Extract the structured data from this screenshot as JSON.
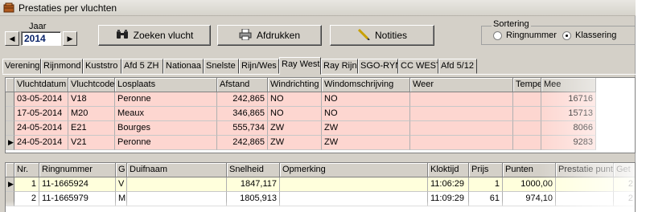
{
  "window": {
    "title": "Prestaties per vluchten"
  },
  "year": {
    "label": "Jaar",
    "value": "2014"
  },
  "buttons": {
    "search": "Zoeken vlucht",
    "print": "Afdrukken",
    "notes": "Notities"
  },
  "sort": {
    "title": "Sortering",
    "options": [
      "Ringnummer",
      "Klassering"
    ],
    "selected": "Klassering"
  },
  "tabs": [
    "Verening",
    "Rijnmond",
    "Kuststro",
    "Afd 5 ZH",
    "Nationaa",
    "Snelste",
    "Rijn/Wes",
    "Ray West",
    "Ray Rijn",
    "SGO-RYN",
    "CC WEST",
    "Afd 5/12"
  ],
  "active_tab": "Ray West",
  "flights": {
    "columns": [
      "Vluchtdatum",
      "Vluchtcode",
      "Losplaats",
      "Afstand",
      "Windrichting",
      "Windomschrijving",
      "Weer",
      "Tempe",
      "Mee"
    ],
    "rows": [
      [
        "03-05-2014",
        "V18",
        "Peronne",
        "242,865",
        "NO",
        "NO",
        "",
        "",
        "16716"
      ],
      [
        "17-05-2014",
        "M20",
        "Meaux",
        "346,865",
        "NO",
        "NO",
        "",
        "",
        "15713"
      ],
      [
        "24-05-2014",
        "E21",
        "Bourges",
        "555,734",
        "ZW",
        "ZW",
        "",
        "",
        "8066"
      ],
      [
        "24-05-2014",
        "V21",
        "Peronne",
        "242,865",
        "ZW",
        "ZW",
        "",
        "",
        "9283"
      ]
    ]
  },
  "results": {
    "columns": [
      "Nr.",
      "Ringnummer",
      "G",
      "Duifnaam",
      "Snelheid",
      "Opmerking",
      "Kloktijd",
      "Prijs",
      "Punten",
      "Prestatie punt",
      "Get"
    ],
    "rows": [
      [
        "1",
        "11-1665924",
        "V",
        "",
        "1847,117",
        "",
        "11:06:29",
        "1",
        "1000,00",
        "",
        "2"
      ],
      [
        "2",
        "11-1665979",
        "M",
        "",
        "1805,913",
        "",
        "11:09:29",
        "61",
        "974,10",
        "",
        "2"
      ]
    ]
  },
  "colors": {
    "window": "#d4d0c8",
    "row_pink": "#fdd6d0",
    "row_yellow": "#ffffdc",
    "year_text": "#0a246a"
  }
}
